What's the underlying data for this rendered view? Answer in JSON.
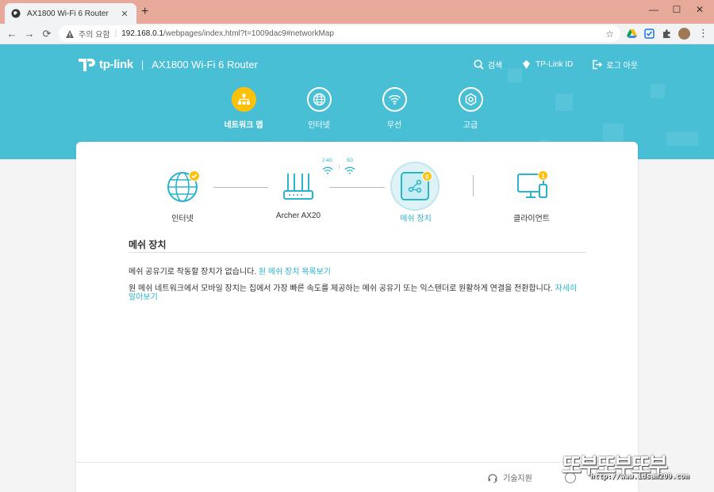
{
  "browser": {
    "tab_title": "AX1800 Wi-Fi 6 Router",
    "tab_close": "✕",
    "new_tab": "+",
    "window_controls": {
      "minimize": "—",
      "maximize": "☐",
      "close": "✕"
    },
    "back": "←",
    "forward": "→",
    "reload": "⟳",
    "security_warning": "주의 요함",
    "url_separator": "|",
    "url_host": "192.168.0.1",
    "url_path": "/webpages/index.html?t=1009dac9#networkMap",
    "bookmark": "☆",
    "menu": "⋮"
  },
  "header": {
    "logo_text": "tp-link",
    "brand_separator": "|",
    "product_name": "AX1800 Wi-Fi 6 Router",
    "links": {
      "search": "검색",
      "tplink_id": "TP-Link ID",
      "logout": "로그 아웃"
    }
  },
  "nav": {
    "items": [
      {
        "label": "네트워크 맵",
        "icon": "network-map-icon",
        "active": true
      },
      {
        "label": "인터넷",
        "icon": "globe-icon",
        "active": false
      },
      {
        "label": "무선",
        "icon": "wifi-icon",
        "active": false
      },
      {
        "label": "고급",
        "icon": "gear-icon",
        "active": false
      }
    ]
  },
  "network_map": {
    "internet_label": "인터넷",
    "router_label": "Archer AX20",
    "band_24": "2.4G",
    "band_5": "5G",
    "band_separator": "|",
    "mesh_label": "메쉬 장치",
    "mesh_count": "0",
    "clients_label": "클라이언트",
    "clients_count": "1"
  },
  "mesh_section": {
    "title": "메쉬 장치",
    "no_devices_text": "메쉬 공유기로 작동할 장치가 없습니다.",
    "list_link": "원 메쉬 장치 목록보기",
    "description": "원 메쉬 네트워크에서 모바일 장치는 집에서 가장 빠른 속도를 제공하는 메쉬 공유기 또는 익스텐더로 원활하게 연결을 전환합니다.",
    "learn_more_link": "자세히 알아보기"
  },
  "footer": {
    "support": "기술지원"
  },
  "watermark": {
    "title": "또부또부또부",
    "url": "http://www.idsam209.com"
  },
  "colors": {
    "header_bg": "#49bfd6",
    "accent": "#2ab4cc",
    "active_nav": "#ffc107",
    "tab_bar": "#e6a99a"
  }
}
